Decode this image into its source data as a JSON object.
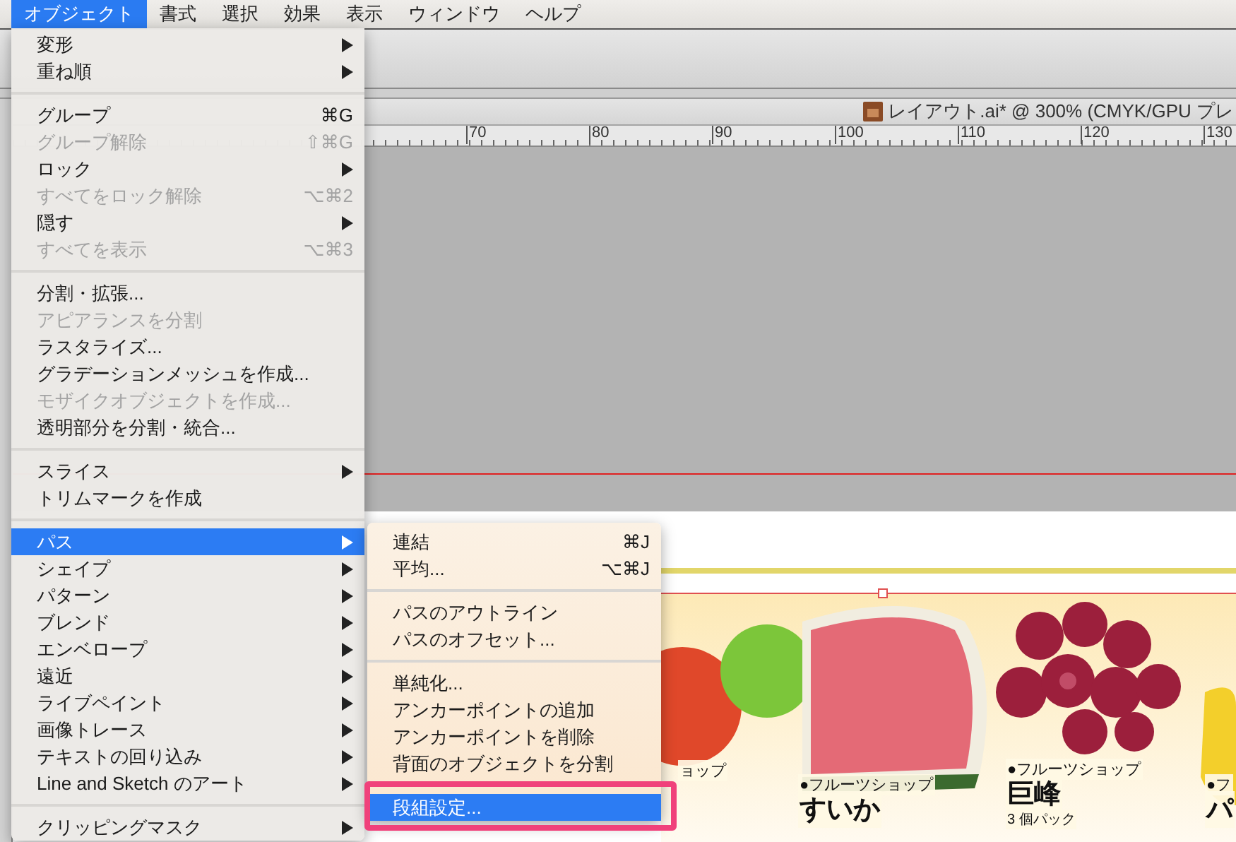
{
  "menubar": [
    {
      "label": "オブジェクト",
      "selected": true
    },
    {
      "label": "書式",
      "selected": false
    },
    {
      "label": "選択",
      "selected": false
    },
    {
      "label": "効果",
      "selected": false
    },
    {
      "label": "表示",
      "selected": false
    },
    {
      "label": "ウィンドウ",
      "selected": false
    },
    {
      "label": "ヘルプ",
      "selected": false
    }
  ],
  "document": {
    "title": "レイアウト.ai* @ 300% (CMYK/GPU プレ",
    "ruler": [
      "70",
      "80",
      "90",
      "100",
      "110",
      "120",
      "130"
    ]
  },
  "menu": {
    "items": [
      {
        "kind": "item",
        "label": "変形",
        "submenu": true,
        "disabled": false,
        "selected": false
      },
      {
        "kind": "item",
        "label": "重ね順",
        "submenu": true,
        "disabled": false,
        "selected": false
      },
      {
        "kind": "separator"
      },
      {
        "kind": "item",
        "label": "グループ",
        "shortcut": "⌘G",
        "disabled": false,
        "selected": false
      },
      {
        "kind": "item",
        "label": "グループ解除",
        "shortcut": "⇧⌘G",
        "disabled": true,
        "selected": false
      },
      {
        "kind": "item",
        "label": "ロック",
        "submenu": true,
        "disabled": false,
        "selected": false
      },
      {
        "kind": "item",
        "label": "すべてをロック解除",
        "shortcut": "⌥⌘2",
        "disabled": true,
        "selected": false
      },
      {
        "kind": "item",
        "label": "隠す",
        "submenu": true,
        "disabled": false,
        "selected": false
      },
      {
        "kind": "item",
        "label": "すべてを表示",
        "shortcut": "⌥⌘3",
        "disabled": true,
        "selected": false
      },
      {
        "kind": "separator"
      },
      {
        "kind": "item",
        "label": "分割・拡張...",
        "disabled": false,
        "selected": false
      },
      {
        "kind": "item",
        "label": "アピアランスを分割",
        "disabled": true,
        "selected": false
      },
      {
        "kind": "item",
        "label": "ラスタライズ...",
        "disabled": false,
        "selected": false
      },
      {
        "kind": "item",
        "label": "グラデーションメッシュを作成...",
        "disabled": false,
        "selected": false
      },
      {
        "kind": "item",
        "label": "モザイクオブジェクトを作成...",
        "disabled": true,
        "selected": false
      },
      {
        "kind": "item",
        "label": "透明部分を分割・統合...",
        "disabled": false,
        "selected": false
      },
      {
        "kind": "separator"
      },
      {
        "kind": "item",
        "label": "スライス",
        "submenu": true,
        "disabled": false,
        "selected": false
      },
      {
        "kind": "item",
        "label": "トリムマークを作成",
        "disabled": false,
        "selected": false
      },
      {
        "kind": "separator"
      },
      {
        "kind": "item",
        "label": "パス",
        "submenu": true,
        "disabled": false,
        "selected": true
      },
      {
        "kind": "item",
        "label": "シェイプ",
        "submenu": true,
        "disabled": false,
        "selected": false
      },
      {
        "kind": "item",
        "label": "パターン",
        "submenu": true,
        "disabled": false,
        "selected": false
      },
      {
        "kind": "item",
        "label": "ブレンド",
        "submenu": true,
        "disabled": false,
        "selected": false
      },
      {
        "kind": "item",
        "label": "エンベロープ",
        "submenu": true,
        "disabled": false,
        "selected": false
      },
      {
        "kind": "item",
        "label": "遠近",
        "submenu": true,
        "disabled": false,
        "selected": false
      },
      {
        "kind": "item",
        "label": "ライブペイント",
        "submenu": true,
        "disabled": false,
        "selected": false
      },
      {
        "kind": "item",
        "label": "画像トレース",
        "submenu": true,
        "disabled": false,
        "selected": false
      },
      {
        "kind": "item",
        "label": "テキストの回り込み",
        "submenu": true,
        "disabled": false,
        "selected": false
      },
      {
        "kind": "item",
        "label": "Line and Sketch のアート",
        "submenu": true,
        "disabled": false,
        "selected": false
      },
      {
        "kind": "separator"
      },
      {
        "kind": "item",
        "label": "クリッピングマスク",
        "submenu": true,
        "disabled": false,
        "selected": false
      }
    ]
  },
  "submenu": {
    "items": [
      {
        "kind": "item",
        "label": "連結",
        "shortcut": "⌘J",
        "selected": false
      },
      {
        "kind": "item",
        "label": "平均...",
        "shortcut": "⌥⌘J",
        "selected": false
      },
      {
        "kind": "separator"
      },
      {
        "kind": "item",
        "label": "パスのアウトライン",
        "selected": false
      },
      {
        "kind": "item",
        "label": "パスのオフセット...",
        "selected": false
      },
      {
        "kind": "separator"
      },
      {
        "kind": "item",
        "label": "単純化...",
        "selected": false
      },
      {
        "kind": "item",
        "label": "アンカーポイントの追加",
        "selected": false
      },
      {
        "kind": "item",
        "label": "アンカーポイントを削除",
        "selected": false
      },
      {
        "kind": "item",
        "label": "背面のオブジェクトを分割",
        "selected": false
      },
      {
        "kind": "separator"
      },
      {
        "kind": "item",
        "label": "段組設定...",
        "selected": true,
        "highlighted": true
      }
    ]
  },
  "products": [
    {
      "shop": "ョップ"
    },
    {
      "shop": "●フルーツショップ",
      "name": "すいか"
    },
    {
      "shop": "●フルーツショップ",
      "name": "巨峰",
      "note": "3 個パック"
    },
    {
      "shop": "●フ",
      "name": "パ"
    }
  ]
}
